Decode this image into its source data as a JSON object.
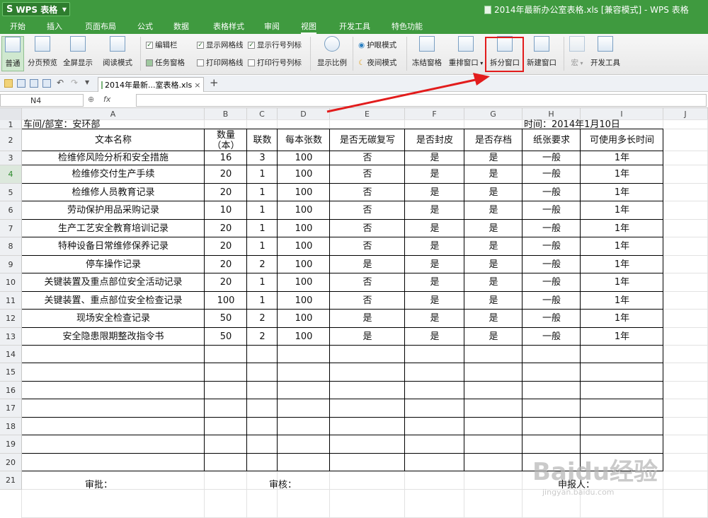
{
  "app": {
    "name": "WPS 表格",
    "document_title": "2014年最新办公室表格.xls [兼容模式] - WPS 表格"
  },
  "menu": {
    "tabs": [
      "开始",
      "插入",
      "页面布局",
      "公式",
      "数据",
      "表格样式",
      "审阅",
      "视图",
      "开发工具",
      "特色功能"
    ],
    "active": "视图"
  },
  "ribbon": {
    "view_normal": "普通",
    "view_page_preview": "分页预览",
    "view_fullscreen": "全屏显示",
    "view_reading": "阅读模式",
    "chk_editbar": "编辑栏",
    "chk_taskpane": "任务窗格",
    "chk_show_grid": "显示网格线",
    "chk_show_headers": "显示行号列标",
    "chk_print_grid": "打印网格线",
    "chk_print_headers": "打印行号列标",
    "zoom": "显示比例",
    "eye_mode": "护眼模式",
    "night_mode": "夜间模式",
    "freeze": "冻结窗格",
    "rearrange": "重排窗口",
    "split": "拆分窗口",
    "new_window": "新建窗口",
    "macro": "宏",
    "dev_tools": "开发工具"
  },
  "quickbar": {
    "doc_tab": "2014年最新...室表格.xls",
    "close": "×",
    "add": "+"
  },
  "formula": {
    "namebox": "N4",
    "fx": "fx",
    "value": ""
  },
  "columns": [
    "A",
    "B",
    "C",
    "D",
    "E",
    "F",
    "G",
    "H",
    "I",
    "J"
  ],
  "rows": [
    "1",
    "2",
    "3",
    "4",
    "5",
    "6",
    "7",
    "8",
    "9",
    "10",
    "11",
    "12",
    "13",
    "14",
    "15",
    "16",
    "17",
    "18",
    "19",
    "20",
    "21"
  ],
  "sheet": {
    "dept": "车间/部室：安环部",
    "time": "时间：2014年1月10日",
    "headers": [
      "文本名称",
      "数量（本）",
      "联数",
      "每本张数",
      "是否无碳复写",
      "是否封皮",
      "是否存档",
      "纸张要求",
      "可使用多长时间"
    ],
    "qty_header_line1": "数量",
    "qty_header_line2": "（本）",
    "data": [
      [
        "检维修风险分析和安全措施",
        "16",
        "3",
        "100",
        "否",
        "是",
        "是",
        "一般",
        "1年"
      ],
      [
        "检维修交付生产手续",
        "20",
        "1",
        "100",
        "否",
        "是",
        "是",
        "一般",
        "1年"
      ],
      [
        "检维修人员教育记录",
        "20",
        "1",
        "100",
        "否",
        "是",
        "是",
        "一般",
        "1年"
      ],
      [
        "劳动保护用品采购记录",
        "10",
        "1",
        "100",
        "否",
        "是",
        "是",
        "一般",
        "1年"
      ],
      [
        "生产工艺安全教育培训记录",
        "20",
        "1",
        "100",
        "否",
        "是",
        "是",
        "一般",
        "1年"
      ],
      [
        "特种设备日常维修保养记录",
        "20",
        "1",
        "100",
        "否",
        "是",
        "是",
        "一般",
        "1年"
      ],
      [
        "停车操作记录",
        "20",
        "2",
        "100",
        "是",
        "是",
        "是",
        "一般",
        "1年"
      ],
      [
        "关键装置及重点部位安全活动记录",
        "20",
        "1",
        "100",
        "否",
        "是",
        "是",
        "一般",
        "1年"
      ],
      [
        "关键装置、重点部位安全检查记录",
        "100",
        "1",
        "100",
        "否",
        "是",
        "是",
        "一般",
        "1年"
      ],
      [
        "现场安全检查记录",
        "50",
        "2",
        "100",
        "是",
        "是",
        "是",
        "一般",
        "1年"
      ],
      [
        "安全隐患限期整改指令书",
        "50",
        "2",
        "100",
        "是",
        "是",
        "是",
        "一般",
        "1年"
      ]
    ],
    "footer": {
      "approve": "审批：",
      "review": "审核：",
      "reporter": "申报人："
    }
  },
  "watermark": {
    "brand": "Baidu经验",
    "url": "jingyan.baidu.com"
  }
}
